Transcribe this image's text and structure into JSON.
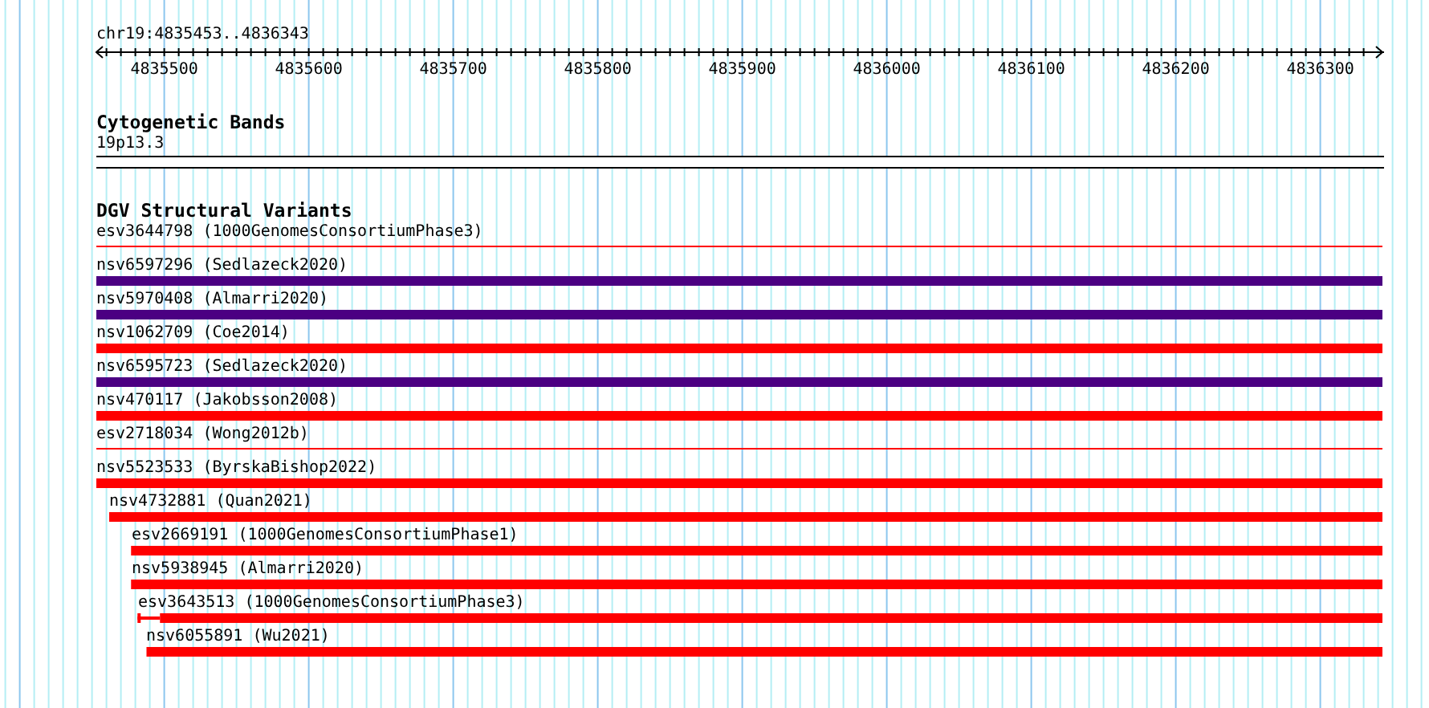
{
  "ruler": {
    "position": "chr19:4835453..4836343",
    "tick_labels": [
      "4835500",
      "4835600",
      "4835700",
      "4835800",
      "4835900",
      "4836000",
      "4836100",
      "4836200",
      "4836300"
    ]
  },
  "cytogenetic_bands": {
    "title": "Cytogenetic Bands",
    "band": "19p13.3"
  },
  "dgv_variants": {
    "title": "DGV Structural Variants",
    "items": [
      {
        "label": "esv3644798 (1000GenomesConsortiumPhase3)",
        "color": "#ff0000",
        "kind": "line",
        "level": 1
      },
      {
        "label": "nsv6597296 (Sedlazeck2020)",
        "color": "#4b0082",
        "kind": "bar",
        "level": 1
      },
      {
        "label": "nsv5970408 (Almarri2020)",
        "color": "#4b0082",
        "kind": "bar",
        "level": 1
      },
      {
        "label": "nsv1062709 (Coe2014)",
        "color": "#ff0000",
        "kind": "bar",
        "level": 1
      },
      {
        "label": "nsv6595723 (Sedlazeck2020)",
        "color": "#4b0082",
        "kind": "bar",
        "level": 1
      },
      {
        "label": "nsv470117 (Jakobsson2008)",
        "color": "#ff0000",
        "kind": "bar",
        "level": 1
      },
      {
        "label": "esv2718034 (Wong2012b)",
        "color": "#ff0000",
        "kind": "line",
        "level": 1
      },
      {
        "label": "nsv5523533 (ByrskaBishop2022)",
        "color": "#ff0000",
        "kind": "bar",
        "level": 1
      },
      {
        "label": "nsv4732881 (Quan2021)",
        "color": "#ff0000",
        "kind": "bar",
        "level": 0.99
      },
      {
        "label": "esv2669191 (1000GenomesConsortiumPhase1)",
        "color": "#ff0000",
        "kind": "bar",
        "level": 0.973
      },
      {
        "label": "nsv5938945 (Almarri2020)",
        "color": "#ff0000",
        "kind": "bar",
        "level": 0.973
      },
      {
        "label": "esv3643513 (1000GenomesConsortiumPhase3)",
        "color": "#ff0000",
        "kind": "gapped",
        "level": 0.968
      },
      {
        "label": "nsv6055891 (Wu2021)",
        "color": "#ff0000",
        "kind": "bar",
        "level": 0.961
      }
    ]
  }
}
